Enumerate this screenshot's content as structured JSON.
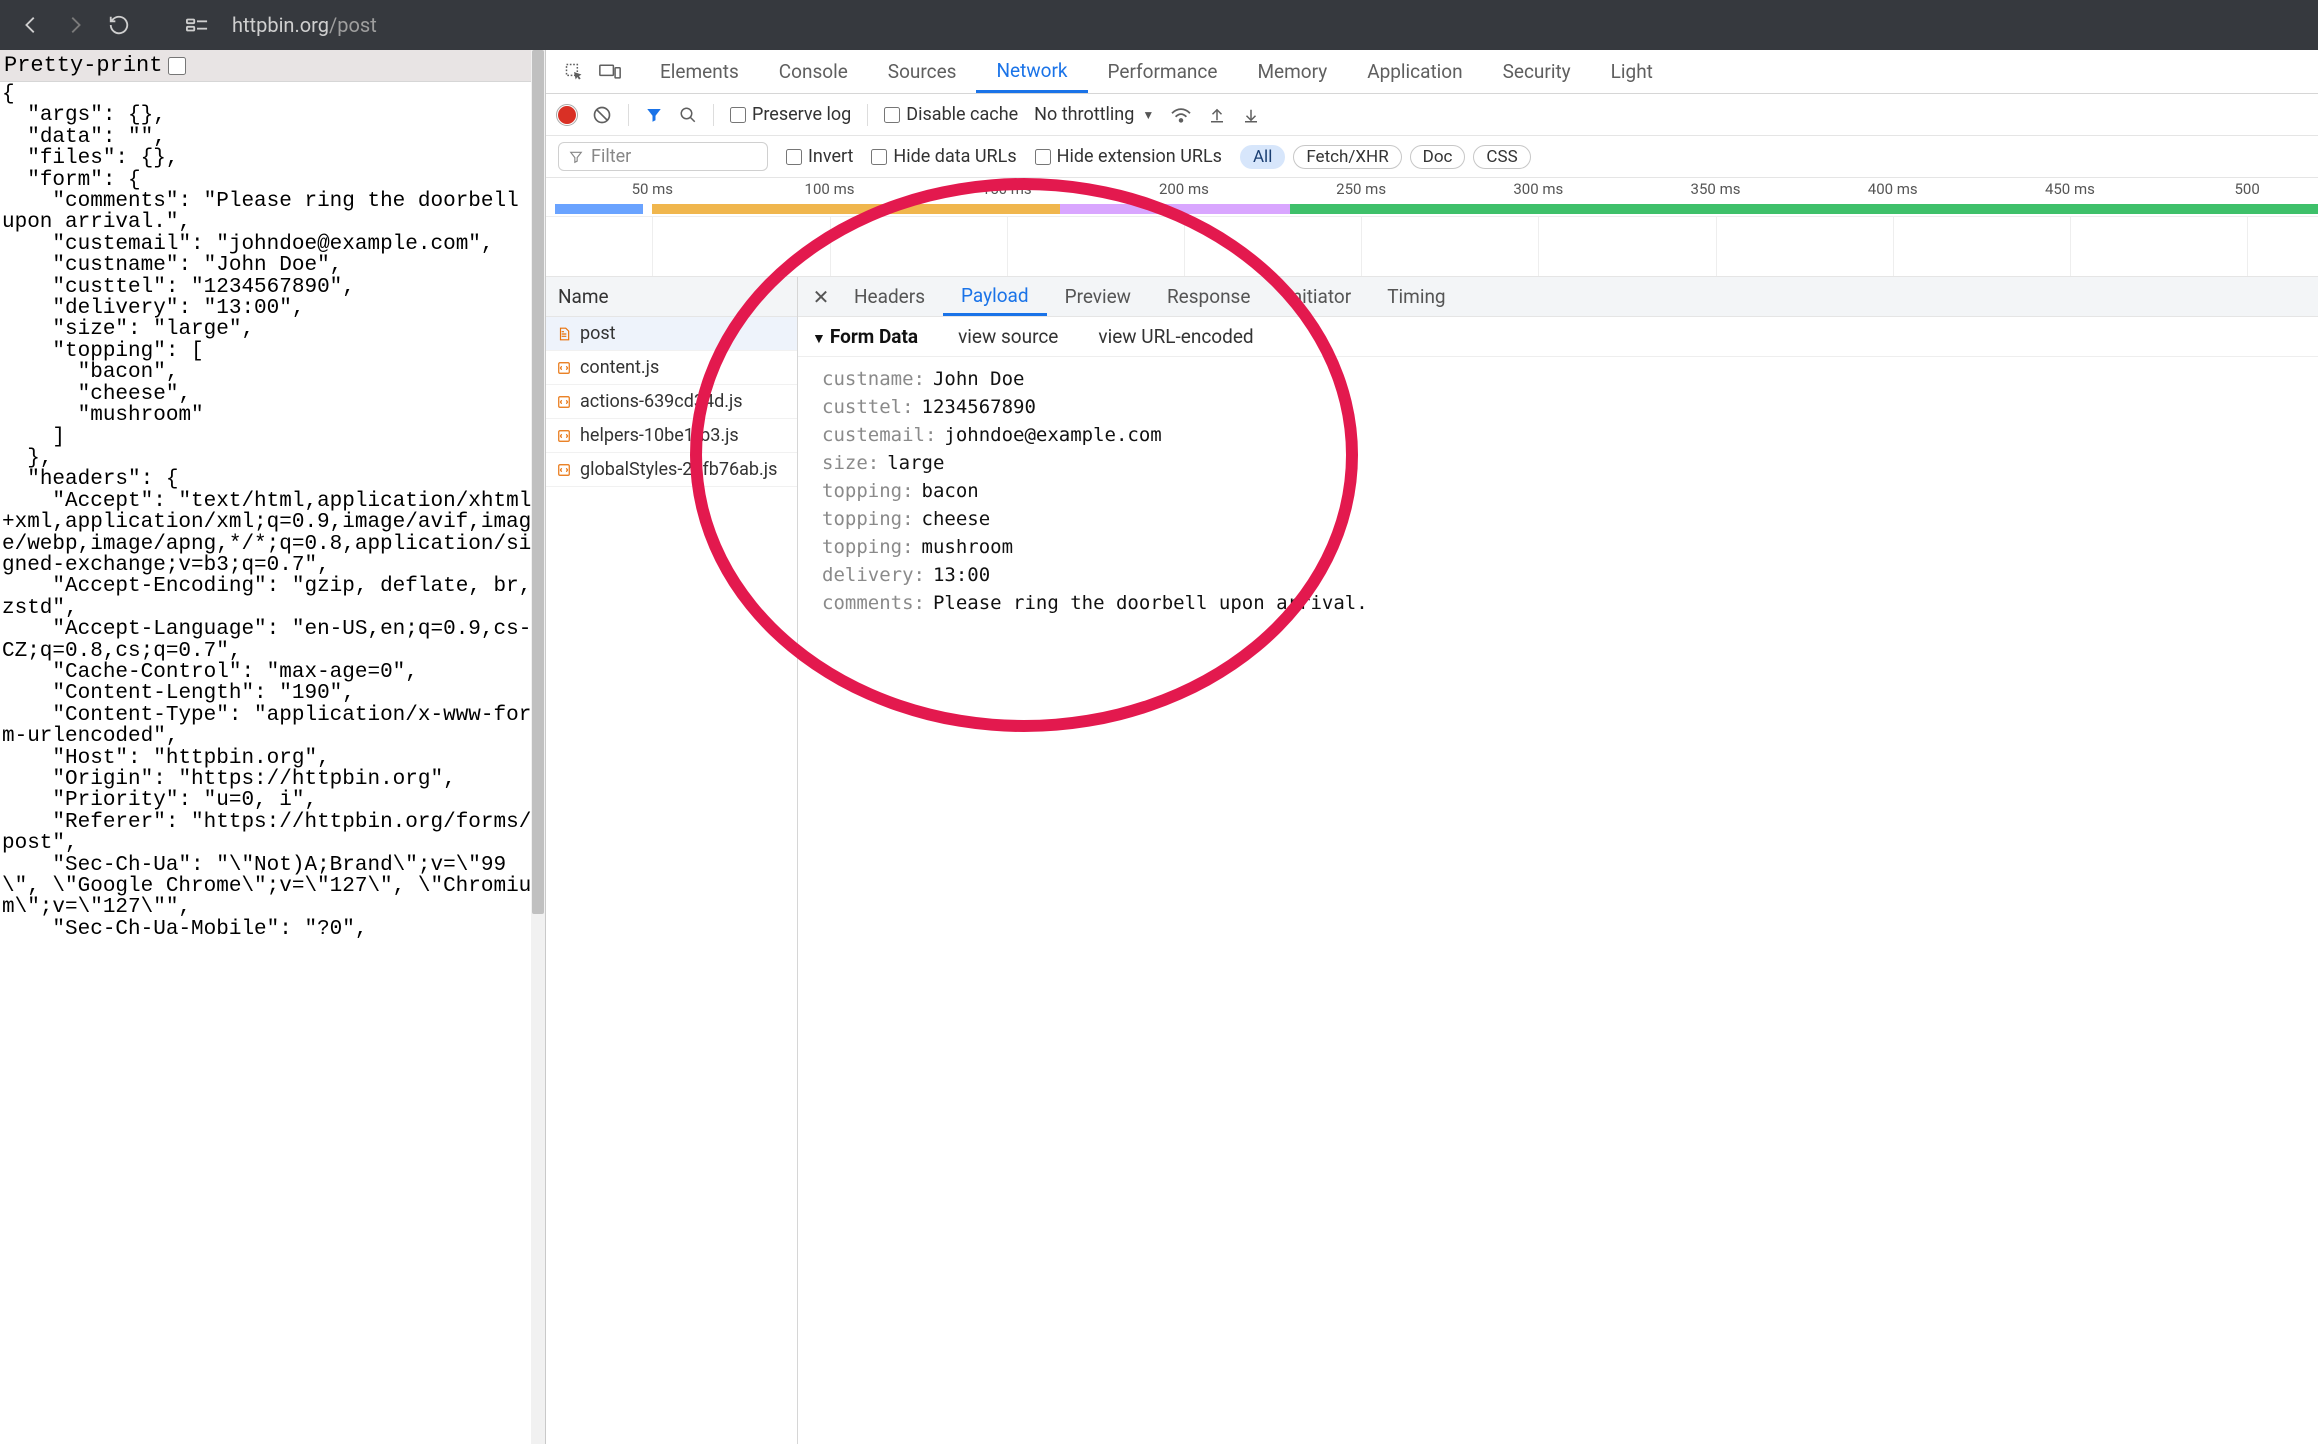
{
  "browser": {
    "url_host": "httpbin.org",
    "url_path": "/post"
  },
  "left": {
    "pretty_label": "Pretty-print",
    "json_text": "{\n  \"args\": {},\n  \"data\": \"\",\n  \"files\": {},\n  \"form\": {\n    \"comments\": \"Please ring the doorbell upon arrival.\",\n    \"custemail\": \"johndoe@example.com\",\n    \"custname\": \"John Doe\",\n    \"custtel\": \"1234567890\",\n    \"delivery\": \"13:00\",\n    \"size\": \"large\",\n    \"topping\": [\n      \"bacon\",\n      \"cheese\",\n      \"mushroom\"\n    ]\n  },\n  \"headers\": {\n    \"Accept\": \"text/html,application/xhtml+xml,application/xml;q=0.9,image/avif,image/webp,image/apng,*/*;q=0.8,application/signed-exchange;v=b3;q=0.7\",\n    \"Accept-Encoding\": \"gzip, deflate, br, zstd\",\n    \"Accept-Language\": \"en-US,en;q=0.9,cs-CZ;q=0.8,cs;q=0.7\",\n    \"Cache-Control\": \"max-age=0\",\n    \"Content-Length\": \"190\",\n    \"Content-Type\": \"application/x-www-form-urlencoded\",\n    \"Host\": \"httpbin.org\",\n    \"Origin\": \"https://httpbin.org\",\n    \"Priority\": \"u=0, i\",\n    \"Referer\": \"https://httpbin.org/forms/post\",\n    \"Sec-Ch-Ua\": \"\\\"Not)A;Brand\\\";v=\\\"99\\\", \\\"Google Chrome\\\";v=\\\"127\\\", \\\"Chromium\\\";v=\\\"127\\\"\",\n    \"Sec-Ch-Ua-Mobile\": \"?0\","
  },
  "devtools": {
    "tabs": [
      "Elements",
      "Console",
      "Sources",
      "Network",
      "Performance",
      "Memory",
      "Application",
      "Security",
      "Light"
    ],
    "active_tab_index": 3,
    "preserve_log": "Preserve log",
    "disable_cache": "Disable cache",
    "throttling": "No throttling",
    "filter_placeholder": "Filter",
    "invert": "Invert",
    "hide_data_urls": "Hide data URLs",
    "hide_ext_urls": "Hide extension URLs",
    "type_pills": [
      "All",
      "Fetch/XHR",
      "Doc",
      "CSS"
    ],
    "active_pill_index": 0,
    "time_ticks": [
      "50 ms",
      "100 ms",
      "150 ms",
      "200 ms",
      "250 ms",
      "300 ms",
      "350 ms",
      "400 ms",
      "450 ms",
      "500"
    ],
    "req_header": "Name",
    "requests": [
      {
        "icon": "doc",
        "label": "post",
        "selected": true
      },
      {
        "icon": "js",
        "label": "content.js"
      },
      {
        "icon": "js",
        "label": "actions-639cd34d.js"
      },
      {
        "icon": "js",
        "label": "helpers-10be1fb3.js"
      },
      {
        "icon": "js",
        "label": "globalStyles-22fb76ab.js"
      }
    ],
    "detail_tabs": [
      "Headers",
      "Payload",
      "Preview",
      "Response",
      "Initiator",
      "Timing"
    ],
    "detail_active_index": 1,
    "form_data_title": "Form Data",
    "view_source": "view source",
    "view_url_encoded": "view URL-encoded",
    "form_data": [
      {
        "k": "custname:",
        "v": "John Doe"
      },
      {
        "k": "custtel:",
        "v": "1234567890"
      },
      {
        "k": "custemail:",
        "v": "johndoe@example.com"
      },
      {
        "k": "size:",
        "v": "large"
      },
      {
        "k": "topping:",
        "v": "bacon"
      },
      {
        "k": "topping:",
        "v": "cheese"
      },
      {
        "k": "topping:",
        "v": "mushroom"
      },
      {
        "k": "delivery:",
        "v": "13:00"
      },
      {
        "k": "comments:",
        "v": "Please ring the doorbell upon arrival."
      }
    ]
  }
}
